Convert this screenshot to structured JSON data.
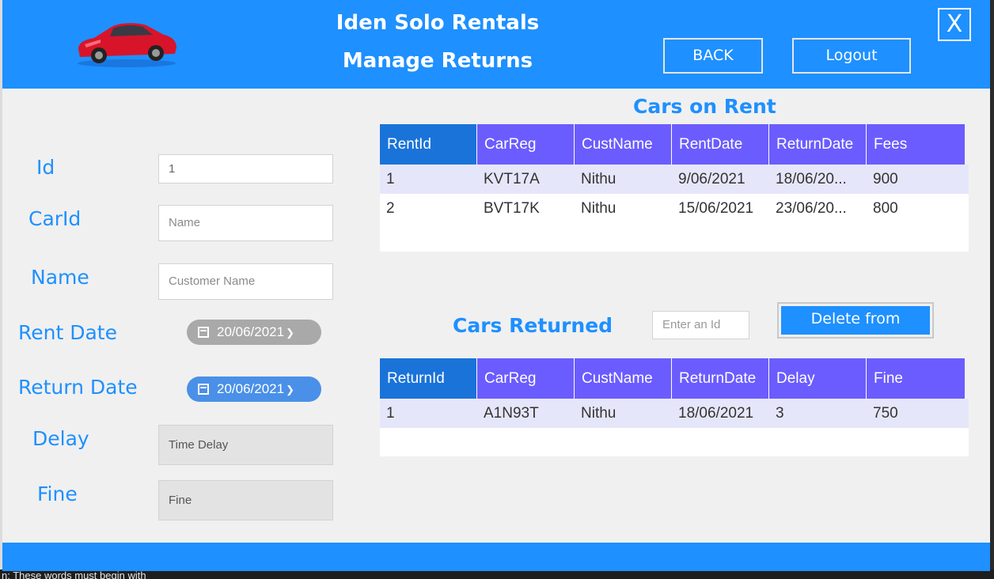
{
  "background": {
    "bottom_text": "n: These words must begin with"
  },
  "header": {
    "title": "Iden Solo Rentals",
    "subtitle": "Manage Returns",
    "back_label": "BACK",
    "logout_label": "Logout",
    "close_label": "X",
    "logo_icon": "red-sports-car-icon"
  },
  "form": {
    "id": {
      "label": "Id",
      "value": "1"
    },
    "car_id": {
      "label": "CarId",
      "placeholder": "Name"
    },
    "name": {
      "label": "Name",
      "placeholder": "Customer Name"
    },
    "rent_date": {
      "label": "Rent Date",
      "value": "20/06/2021",
      "enabled": false
    },
    "return_date": {
      "label": "Return Date",
      "value": "20/06/2021",
      "enabled": true
    },
    "delay": {
      "label": "Delay",
      "placeholder": "Time Delay"
    },
    "fine": {
      "label": "Fine",
      "placeholder": "Fine"
    }
  },
  "rent_table": {
    "title": "Cars on Rent",
    "columns": [
      "RentId",
      "CarReg",
      "CustName",
      "RentDate",
      "ReturnDate",
      "Fees"
    ],
    "rows": [
      [
        "1",
        "KVT17A",
        "Nithu",
        "9/06/2021",
        "18/06/20...",
        "900"
      ],
      [
        "2",
        "BVT17K",
        "Nithu",
        "15/06/2021",
        "23/06/20...",
        "800"
      ]
    ]
  },
  "returns": {
    "title": "Cars Returned",
    "id_placeholder": "Enter an Id",
    "delete_label": "Delete from"
  },
  "return_table": {
    "columns": [
      "ReturnId",
      "CarReg",
      "CustName",
      "ReturnDate",
      "Delay",
      "Fine"
    ],
    "rows": [
      [
        "1",
        "A1N93T",
        "Nithu",
        "18/06/2021",
        "3",
        "750"
      ]
    ]
  },
  "colors": {
    "accent": "#1e90ff",
    "grid_header": "#6b5cff",
    "grid_header_selected": "#1a73d9",
    "row_alt": "#e6e6fa"
  }
}
